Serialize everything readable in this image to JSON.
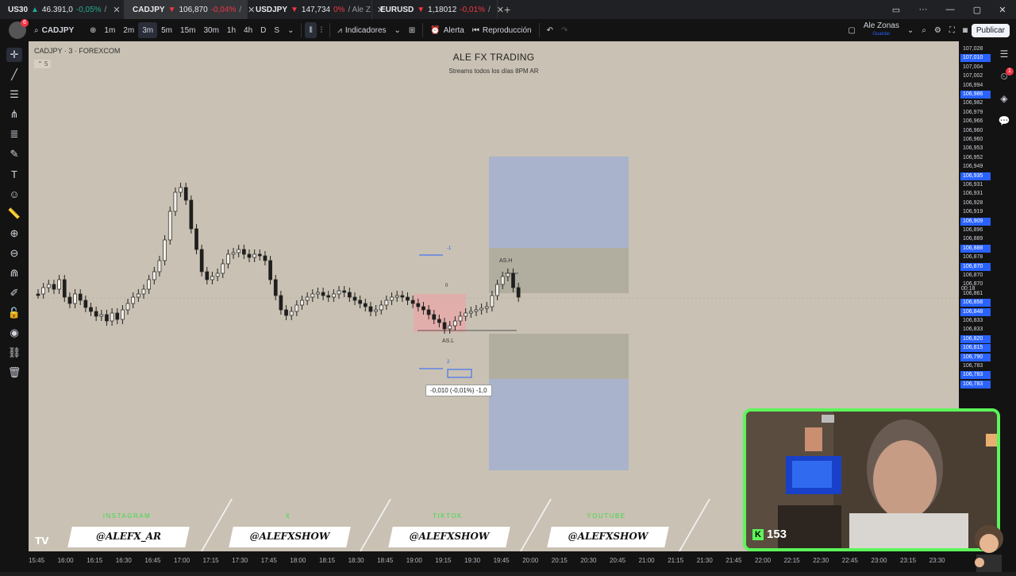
{
  "browser": {
    "tabs": [
      {
        "symbol": "US30",
        "price": "46.391,0",
        "change": "-0,05%",
        "suffix": "/",
        "positive": true,
        "active": false
      },
      {
        "symbol": "CADJPY",
        "price": "106,870",
        "change": "-0,04%",
        "suffix": "/",
        "positive": false,
        "active": true
      },
      {
        "symbol": "USDJPY",
        "price": "147,734",
        "change": "0%",
        "suffix": "/ Ale Z",
        "positive": false,
        "active": false
      },
      {
        "symbol": "EURUSD",
        "price": "1,18012",
        "change": "-0,01%",
        "suffix": "/",
        "positive": false,
        "active": false
      }
    ],
    "new_tab": "+"
  },
  "toolbar": {
    "symbol": "CADJPY",
    "intervals": [
      "1m",
      "2m",
      "3m",
      "5m",
      "15m",
      "30m",
      "1h",
      "4h",
      "D",
      "S"
    ],
    "selected_interval": "3m",
    "indicators_label": "Indicadores",
    "alert_label": "Alerta",
    "replay_label": "Reproducción",
    "layout_name": "Ale Zonas",
    "layout_sub": "Guardar",
    "publish_label": "Publicar",
    "notification_count": "6"
  },
  "chart": {
    "symbol_info": "CADJPY · 3 · FOREXCOM",
    "legend_count": "5",
    "watermark_title": "ALE FX TRADING",
    "watermark_sub": "Streams todos los días 8PM AR",
    "label_ash": "AS.H",
    "label_asl": "AS.L",
    "label_minus1": "-1",
    "label_zero": "0",
    "label_two": "2",
    "measure_readout": "-0,010 (-0,01%) -1,0",
    "countdown": "00:18"
  },
  "price_scale": {
    "labels": [
      "107,028",
      "107,010",
      "107,004",
      "107,002",
      "106,994",
      "106,986",
      "106,982",
      "106,979",
      "106,966",
      "106,960",
      "106,960",
      "106,953",
      "106,952",
      "106,949",
      "106,935",
      "106,931",
      "106,931",
      "106,928",
      "106,919",
      "106,909",
      "106,896",
      "106,889",
      "106,888",
      "106,878",
      "106,870",
      "106,870",
      "106,870",
      "106,861",
      "106,858",
      "106,848",
      "106,833",
      "106,833",
      "106,820",
      "106,815",
      "106,790",
      "106,783",
      "106,783",
      "106,783"
    ],
    "highlighted": [
      1,
      5,
      14,
      19,
      22,
      24,
      28,
      29,
      32,
      33,
      34,
      36,
      37
    ]
  },
  "time_axis": {
    "labels": [
      "15:45",
      "16:00",
      "16:15",
      "16:30",
      "16:45",
      "17:00",
      "17:15",
      "17:30",
      "17:45",
      "18:00",
      "18:15",
      "18:30",
      "18:45",
      "19:00",
      "19:15",
      "19:30",
      "19:45",
      "20:00",
      "20:15",
      "20:30",
      "20:45",
      "21:00",
      "21:15",
      "21:30",
      "21:45",
      "22:00",
      "22:15",
      "22:30",
      "22:45",
      "23:00",
      "23:15",
      "23:30"
    ]
  },
  "social": [
    {
      "platform": "INSTAGRAM",
      "handle": "@ALEFX_AR"
    },
    {
      "platform": "X",
      "handle": "@ALEFXSHOW"
    },
    {
      "platform": "TIKTOK",
      "handle": "@ALEFXSHOW"
    },
    {
      "platform": "YOUTUBE",
      "handle": "@ALEFXSHOW"
    }
  ],
  "stream": {
    "viewer_count": "153",
    "accent_color": "#5cf55a"
  }
}
